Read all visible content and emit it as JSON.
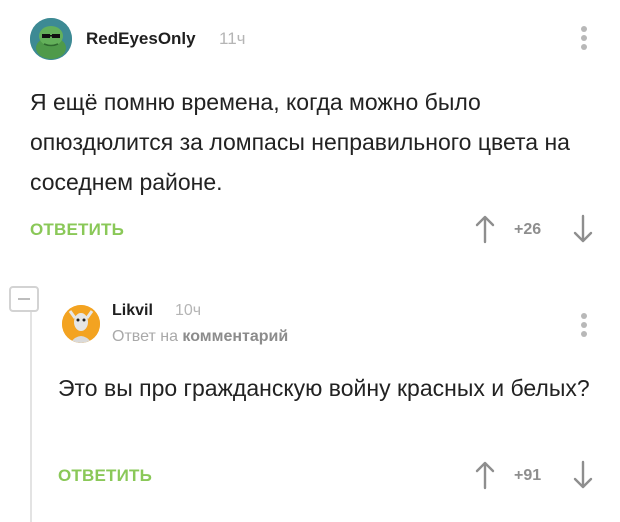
{
  "comments": [
    {
      "author": "RedEyesOnly",
      "time": "11ч",
      "text": "Я ещё помню времена, когда можно было опюздюлится за ломпасы неправильного цвета на соседнем районе.",
      "reply_label": "ОТВЕТИТЬ",
      "score": "+26"
    },
    {
      "author": "Likvil",
      "time": "10ч",
      "reply_prefix": "Ответ на",
      "reply_target": "комментарий",
      "text": "Это вы про гражданскую войну красных и белых?",
      "reply_label": "ОТВЕТИТЬ",
      "score": "+91"
    }
  ],
  "colors": {
    "accent_green": "#8ac858",
    "muted_gray": "#b5b5b5",
    "text": "#222222"
  },
  "icons": {
    "more": "vertical-dots-icon",
    "upvote": "arrow-up-icon",
    "downvote": "arrow-down-icon",
    "collapse": "minus-icon"
  }
}
